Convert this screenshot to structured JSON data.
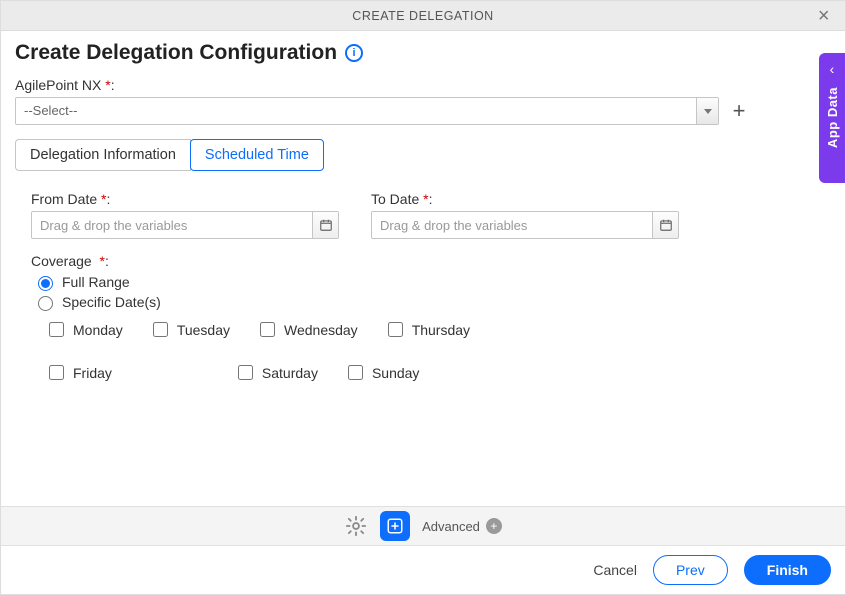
{
  "titlebar": {
    "title": "CREATE DELEGATION"
  },
  "header": {
    "title": "Create Delegation Configuration"
  },
  "app_field": {
    "label": "AgilePoint NX",
    "value": "--Select--"
  },
  "tabs": {
    "info": "Delegation Information",
    "schedule": "Scheduled Time"
  },
  "dates": {
    "from_label": "From Date",
    "to_label": "To Date",
    "placeholder": "Drag & drop the variables"
  },
  "coverage": {
    "label": "Coverage",
    "full": "Full Range",
    "specific": "Specific Date(s)",
    "days": {
      "mon": "Monday",
      "tue": "Tuesday",
      "wed": "Wednesday",
      "thu": "Thursday",
      "fri": "Friday",
      "sat": "Saturday",
      "sun": "Sunday"
    }
  },
  "quickbar": {
    "advanced": "Advanced"
  },
  "footer": {
    "cancel": "Cancel",
    "prev": "Prev",
    "finish": "Finish"
  },
  "side": {
    "label": "App Data"
  }
}
